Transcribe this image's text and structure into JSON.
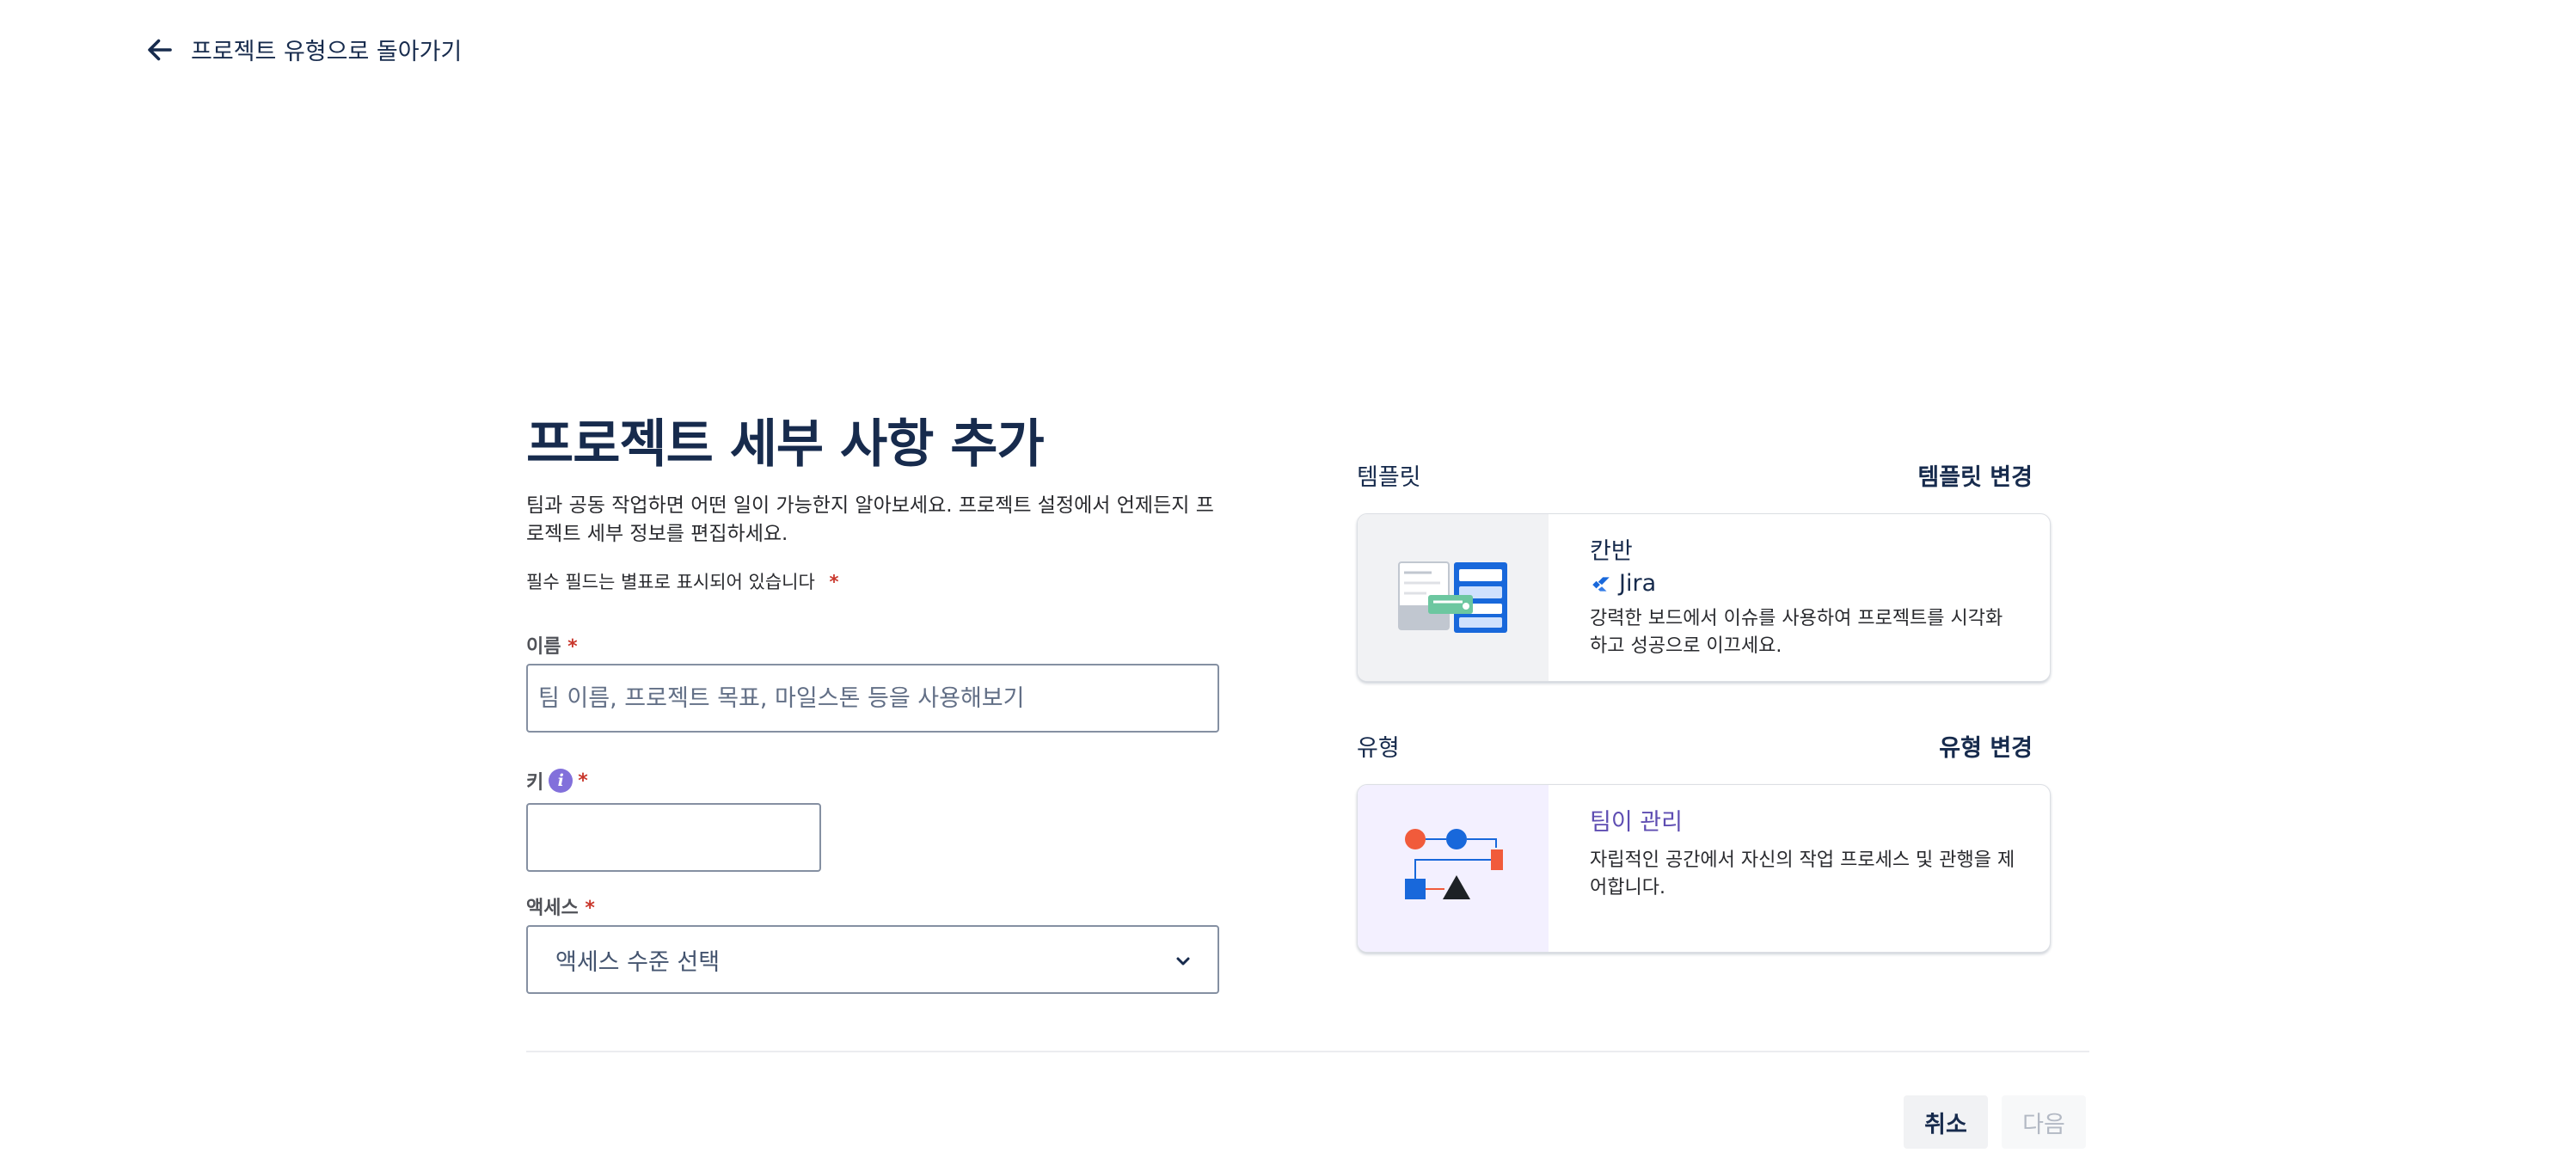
{
  "back_link": {
    "label": "프로젝트 유형으로 돌아가기",
    "icon": "arrow-left-icon"
  },
  "form": {
    "title": "프로젝트 세부 사항 추가",
    "description": "팀과 공동 작업하면 어떤 일이 가능한지 알아보세요. 프로젝트 설정에서 언제든지 프로젝트 세부 정보를 편집하세요.",
    "required_note": "필수 필드는 별표로 표시되어 있습니다",
    "required_marker": "*",
    "name": {
      "label": "이름",
      "value": "",
      "placeholder": "팀 이름, 프로젝트 목표, 마일스톤 등을 사용해보기"
    },
    "key": {
      "label": "키",
      "value": "",
      "info_icon": "info-icon",
      "info_glyph": "i"
    },
    "access": {
      "label": "액세스",
      "selected": "액세스 수준 선택",
      "icon": "chevron-down-icon"
    }
  },
  "template_section": {
    "heading": "템플릿",
    "change_label": "템플릿 변경",
    "card": {
      "title": "칸반",
      "product": "Jira",
      "description": "강력한 보드에서 이슈를 사용하여 프로젝트를 시각화하고 성공으로 이끄세요."
    }
  },
  "type_section": {
    "heading": "유형",
    "change_label": "유형 변경",
    "card": {
      "title": "팀이 관리",
      "description": "자립적인 공간에서 자신의 작업 프로세스 및 관행을 제어합니다."
    }
  },
  "footer": {
    "cancel_label": "취소",
    "next_label": "다음"
  },
  "colors": {
    "text": "#172b4d",
    "required": "#c9372c",
    "jira_blue": "#1868db",
    "team_managed_purple": "#5e4db2",
    "info_icon": "#8270db"
  }
}
